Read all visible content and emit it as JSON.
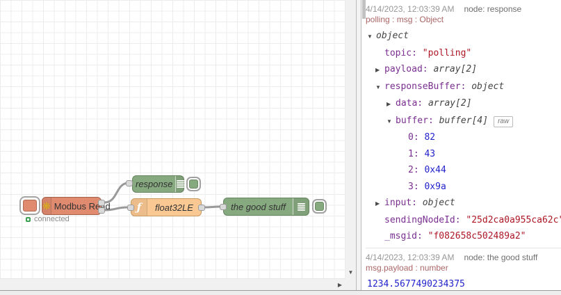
{
  "colors": {
    "modbus": "#E08A6F",
    "debuggreen": "#87A980",
    "funcorange": "#F9C893",
    "keypurple": "#792e90",
    "stringred": "#ad1625",
    "numberblue": "#2222cc",
    "topicred": "#aa6666"
  },
  "flow": {
    "nodes": {
      "modbus": {
        "label": "Modbus Read",
        "status": "connected",
        "icon_glyph": "❋"
      },
      "response": {
        "label": "response"
      },
      "func": {
        "label": "float32LE",
        "icon_glyph": "ƒ"
      },
      "debug2": {
        "label": "the good stuff"
      }
    }
  },
  "scrollbars": {
    "down_glyph": "▼",
    "right_glyph": "▶"
  },
  "debug": {
    "messages": [
      {
        "timestamp": "4/14/2023, 12:03:39 AM",
        "node": "node: response",
        "topic": "polling : msg : Object",
        "rows": [
          {
            "indent": 0,
            "arrow": "down",
            "type": "object"
          },
          {
            "indent": 1,
            "key": "topic:",
            "string": "\"polling\""
          },
          {
            "indent": 1,
            "arrow": "right",
            "key": "payload:",
            "type": "array[2]"
          },
          {
            "indent": 1,
            "arrow": "down",
            "key": "responseBuffer:",
            "type": "object"
          },
          {
            "indent": 2,
            "arrow": "right",
            "key": "data:",
            "type": "array[2]"
          },
          {
            "indent": 2,
            "arrow": "down",
            "key": "buffer:",
            "type": "buffer[4]",
            "badge": "raw"
          },
          {
            "indent": 3,
            "key": "0:",
            "number": "82"
          },
          {
            "indent": 3,
            "key": "1:",
            "number": "43"
          },
          {
            "indent": 3,
            "key": "2:",
            "number": "0x44"
          },
          {
            "indent": 3,
            "key": "3:",
            "number": "0x9a"
          },
          {
            "indent": 1,
            "arrow": "right",
            "key": "input:",
            "type": "object"
          },
          {
            "indent": 1,
            "key": "sendingNodeId:",
            "string": "\"25d2ca0a955ca62c\""
          },
          {
            "indent": 1,
            "key": "_msgid:",
            "string": "\"f082658c502489a2\""
          }
        ]
      },
      {
        "timestamp": "4/14/2023, 12:03:39 AM",
        "node": "node: the good stuff",
        "topic": "msg.payload : number",
        "rows": [
          {
            "indent": 0,
            "number": "1234.5677490234375",
            "bare": true
          }
        ]
      }
    ]
  }
}
